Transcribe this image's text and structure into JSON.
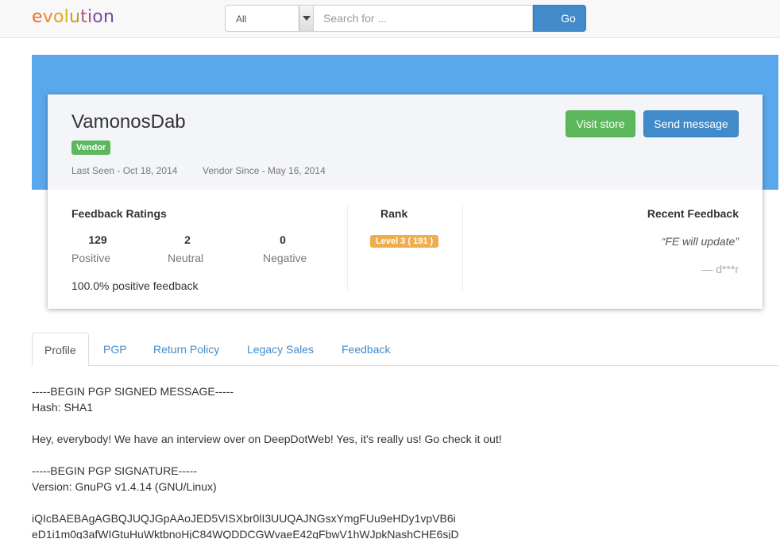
{
  "navbar": {
    "logo_letters": [
      {
        "ch": "e",
        "color": "#f26a2a"
      },
      {
        "ch": "v",
        "color": "#f2862a"
      },
      {
        "ch": "o",
        "color": "#e9a21f"
      },
      {
        "ch": "l",
        "color": "#d9b21a"
      },
      {
        "ch": "u",
        "color": "#c39a2a"
      },
      {
        "ch": "t",
        "color": "#b0567a"
      },
      {
        "ch": "i",
        "color": "#9a4e98"
      },
      {
        "ch": "o",
        "color": "#7e4aa6"
      },
      {
        "ch": "n",
        "color": "#6a46a8"
      }
    ],
    "search": {
      "category": "All",
      "placeholder": "Search for ...",
      "button_label": "Go"
    }
  },
  "profile": {
    "name": "VamonosDab",
    "badge": "Vendor",
    "last_seen": "Last Seen - Oct 18, 2014",
    "vendor_since": "Vendor Since - May 16, 2014",
    "visit_store_label": "Visit store",
    "send_message_label": "Send message"
  },
  "feedback_ratings": {
    "title": "Feedback Ratings",
    "stats": [
      {
        "count": "129",
        "label": "Positive"
      },
      {
        "count": "2",
        "label": "Neutral"
      },
      {
        "count": "0",
        "label": "Negative"
      }
    ],
    "positive_percent": "100.0% positive feedback"
  },
  "rank": {
    "title": "Rank",
    "badge": "Level 3 ( 191 )"
  },
  "recent_feedback": {
    "title": "Recent Feedback",
    "quote": "“FE will update”",
    "author": "— d***r"
  },
  "tabs": [
    {
      "label": "Profile",
      "active": true
    },
    {
      "label": "PGP",
      "active": false
    },
    {
      "label": "Return Policy",
      "active": false
    },
    {
      "label": "Legacy Sales",
      "active": false
    },
    {
      "label": "Feedback",
      "active": false
    }
  ],
  "profile_text": [
    "-----BEGIN PGP SIGNED MESSAGE-----",
    "Hash: SHA1",
    "",
    "Hey, everybody! We have an interview over on DeepDotWeb! Yes, it's really us! Go check it out!",
    "",
    "-----BEGIN PGP SIGNATURE-----",
    "Version: GnuPG v1.4.14 (GNU/Linux)",
    "",
    "iQIcBAEBAgAGBQJUQJGpAAoJED5VISXbr0lI3UUQAJNGsxYmgFUu9eHDy1vpVB6i",
    "eD1i1m0g3afWIGtuHuWktbnoHjC84WQDDCGWvaeE42qFbwV1hWJpkNashCHE6sjD"
  ]
}
